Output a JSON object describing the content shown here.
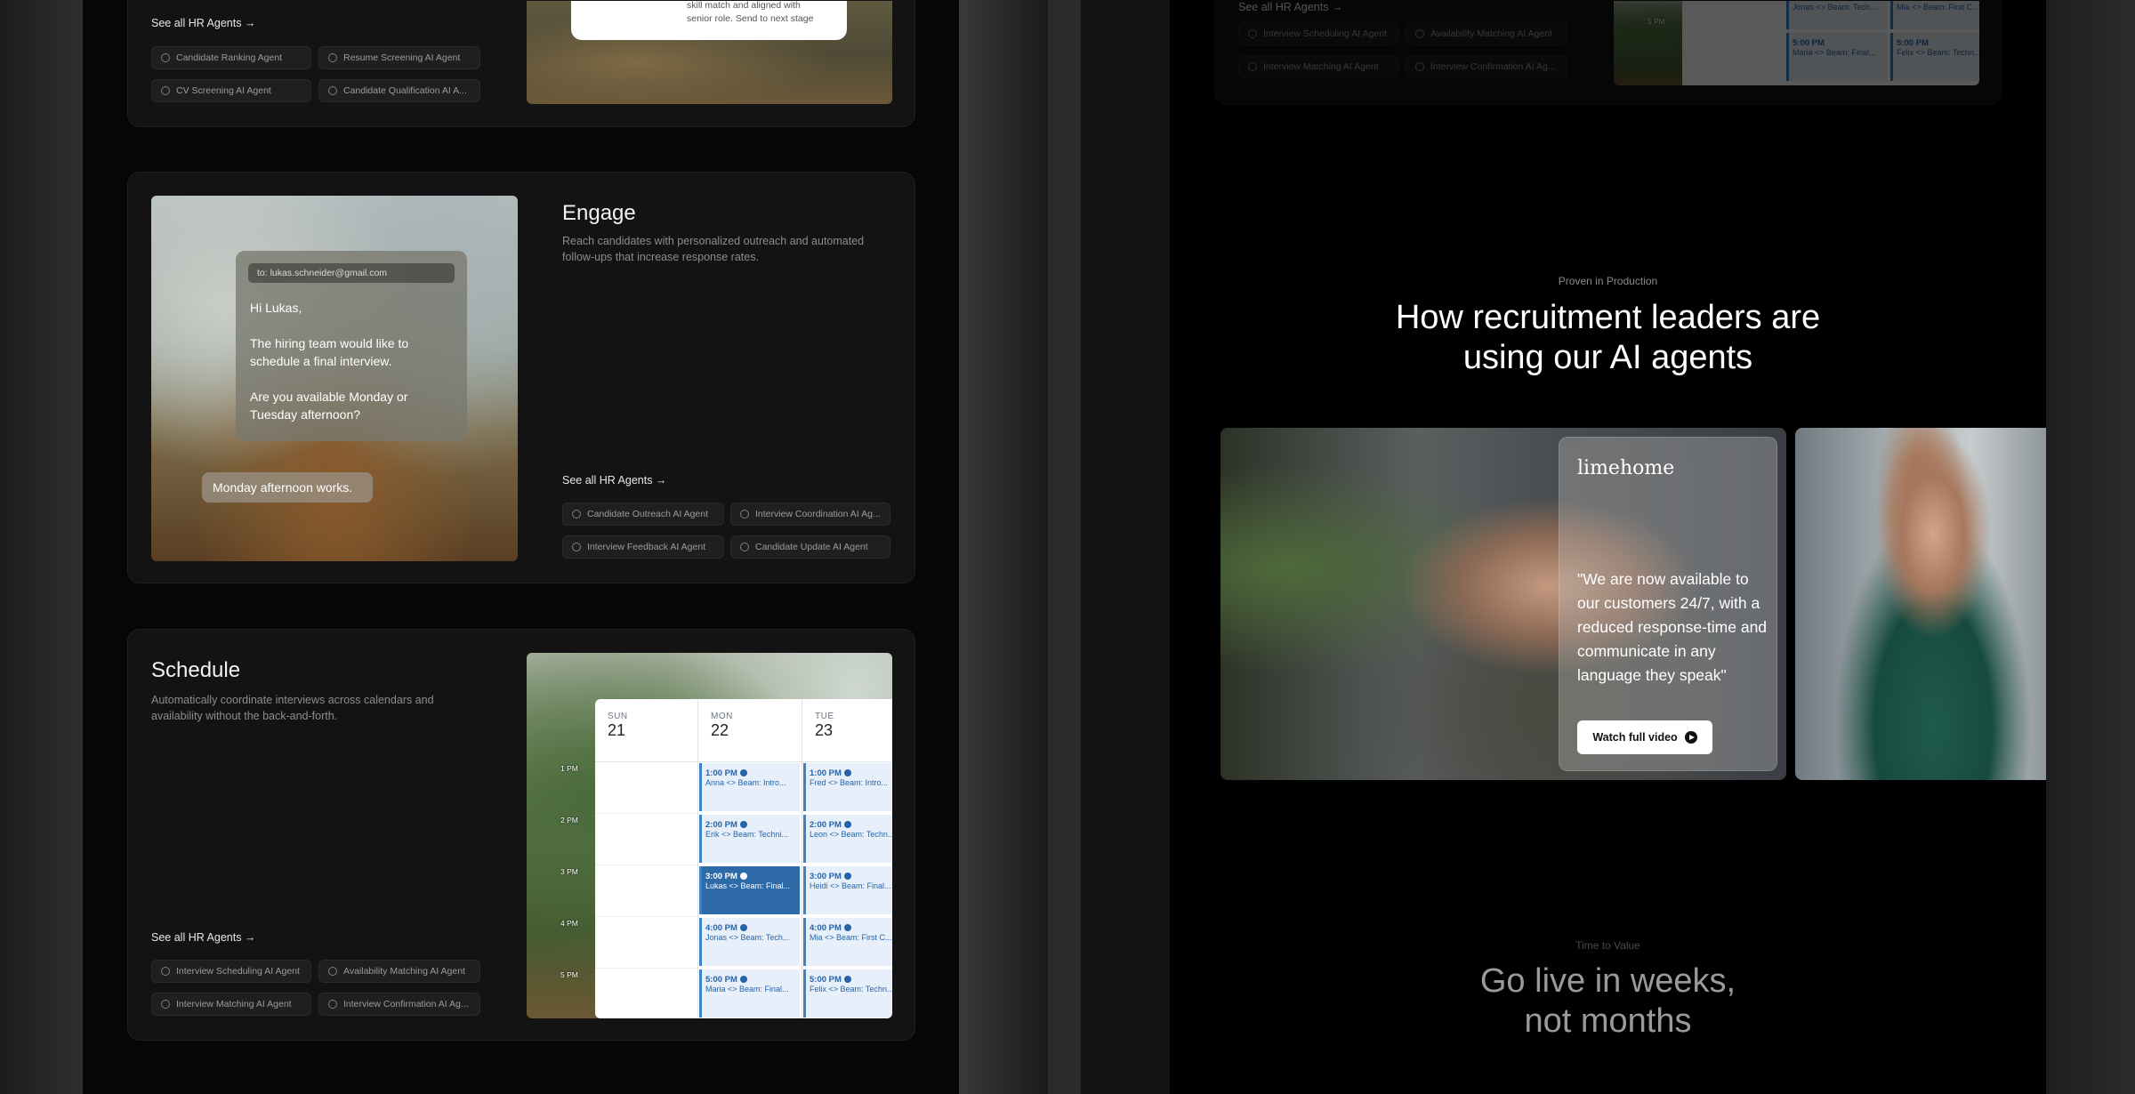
{
  "top_card": {
    "see_all": "See all HR Agents →",
    "chips": [
      "Candidate Ranking Agent",
      "Resume Screening AI Agent",
      "CV Screening AI Agent",
      "Candidate Qualification AI A..."
    ],
    "note_lines": [
      "skill match and aligned with",
      "senior role. Send to next stage"
    ]
  },
  "engage": {
    "title": "Engage",
    "description": "Reach candidates with personalized outreach and automated follow-ups that increase response rates.",
    "email_to": "to: lukas.schneider@gmail.com",
    "greeting": "Hi Lukas,",
    "body1": "The hiring team would like to schedule a final interview.",
    "body2": "Are you available Monday or Tuesday afternoon?",
    "reply": "Monday afternoon works.",
    "see_all": "See all HR Agents →",
    "chips": [
      "Candidate Outreach AI Agent",
      "Interview Coordination AI Ag...",
      "Interview Feedback AI Agent",
      "Candidate Update AI Agent"
    ]
  },
  "schedule": {
    "title": "Schedule",
    "description": "Automatically coordinate interviews across calendars and availability without the back-and-forth.",
    "see_all": "See all HR Agents →",
    "chips": [
      "Interview Scheduling AI Agent",
      "Availability Matching AI Agent",
      "Interview Matching AI Agent",
      "Interview Confirmation AI Ag..."
    ],
    "calendar": {
      "days": [
        {
          "label": "SUN",
          "num": "21"
        },
        {
          "label": "MON",
          "num": "22"
        },
        {
          "label": "TUE",
          "num": "23"
        }
      ],
      "times": [
        "1 PM",
        "2 PM",
        "3 PM",
        "4 PM",
        "5 PM"
      ],
      "mon": [
        {
          "time": "1:00 PM",
          "desc": "Anna <> Beam: Intro..."
        },
        {
          "time": "2:00 PM",
          "desc": "Erik <> Beam: Techni..."
        },
        {
          "time": "3:00 PM",
          "desc": "Lukas <> Beam: Final..."
        },
        {
          "time": "4:00 PM",
          "desc": "Jonas <> Beam: Tech..."
        },
        {
          "time": "5:00 PM",
          "desc": "Maria <> Beam: Final..."
        }
      ],
      "tue": [
        {
          "time": "1:00 PM",
          "desc": "Fred <> Beam: Intro..."
        },
        {
          "time": "2:00 PM",
          "desc": "Leon <> Beam: Techn..."
        },
        {
          "time": "3:00 PM",
          "desc": "Heidi <> Beam: Final..."
        },
        {
          "time": "4:00 PM",
          "desc": "Mia <> Beam: First C..."
        },
        {
          "time": "5:00 PM",
          "desc": "Felix <> Beam: Techn..."
        }
      ]
    }
  },
  "right_top": {
    "see_all": "See all HR Agents →",
    "chips": [
      "Interview Scheduling AI Agent",
      "Availability Matching AI Agent",
      "Interview Matching AI Agent",
      "Interview Confirmation AI Ag..."
    ],
    "time": "5 PM",
    "slots": [
      {
        "time": "",
        "desc": "Jonas <> Beam: Tech..."
      },
      {
        "time": "",
        "desc": "Mia <> Beam: First C..."
      },
      {
        "time": "5:00 PM",
        "desc": "Maria <> Beam: Final..."
      },
      {
        "time": "5:00 PM",
        "desc": "Felix <> Beam: Techn..."
      }
    ]
  },
  "proof": {
    "eyebrow": "Proven in Production",
    "heading_line1": "How recruitment leaders are",
    "heading_line2": "using our AI agents",
    "brand": "limehome",
    "quote": "\"We are now available to our customers 24/7, with a reduced response-time and communicate in any language they speak\"",
    "watch": "Watch full video"
  },
  "ttv": {
    "eyebrow": "Time to Value",
    "heading_line1": "Go live in weeks,",
    "heading_line2": "not months"
  }
}
